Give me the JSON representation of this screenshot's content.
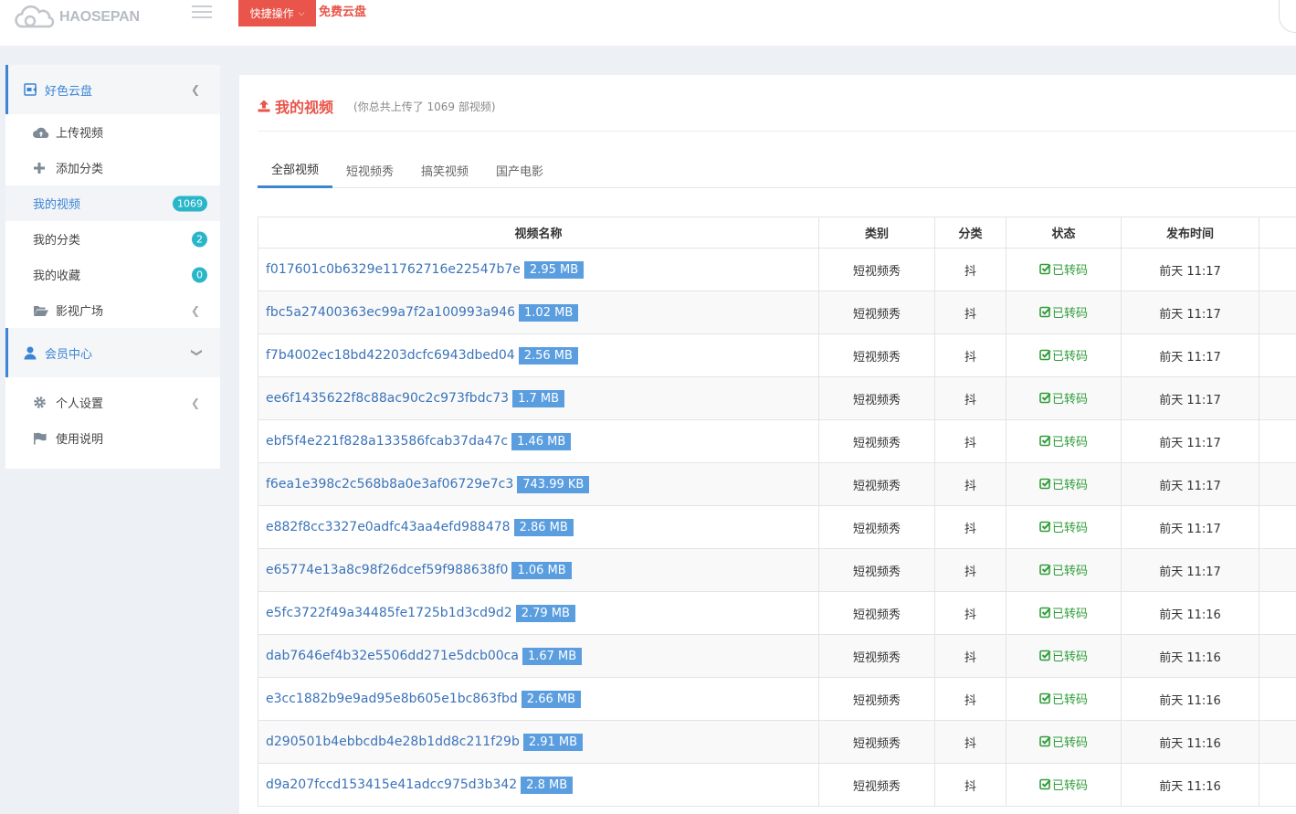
{
  "header": {
    "logo_text": "HAOSEPAN",
    "quick_actions_label": "快捷操作",
    "free_cloud_link": "免费云盘"
  },
  "sidebar": {
    "section1": {
      "label": "好色云盘"
    },
    "items": [
      {
        "label": "上传视频",
        "icon": "cloud-upload-icon"
      },
      {
        "label": "添加分类",
        "icon": "plus-icon"
      },
      {
        "label": "我的视频",
        "badge": "1069"
      },
      {
        "label": "我的分类",
        "badge": "2"
      },
      {
        "label": "我的收藏",
        "badge": "0"
      },
      {
        "label": "影视广场",
        "icon": "folder-open-icon"
      }
    ],
    "section2": {
      "label": "会员中心"
    },
    "items2": [
      {
        "label": "个人设置",
        "icon": "gear-icon"
      },
      {
        "label": "使用说明",
        "icon": "flag-icon"
      }
    ]
  },
  "main": {
    "title": "我的视频",
    "subtitle": "(你总共上传了 1069 部视频)",
    "tabs": [
      "全部视频",
      "短视频秀",
      "搞笑视频",
      "国产电影"
    ],
    "table": {
      "headers": [
        "视频名称",
        "类别",
        "分类",
        "状态",
        "发布时间"
      ],
      "rows": [
        {
          "name": "f017601c0b6329e11762716e22547b7e",
          "size": "2.95 MB",
          "category": "短视频秀",
          "tag": "抖",
          "status": "已转码",
          "time": "前天 11:17"
        },
        {
          "name": "fbc5a27400363ec99a7f2a100993a946",
          "size": "1.02 MB",
          "category": "短视频秀",
          "tag": "抖",
          "status": "已转码",
          "time": "前天 11:17"
        },
        {
          "name": "f7b4002ec18bd42203dcfc6943dbed04",
          "size": "2.56 MB",
          "category": "短视频秀",
          "tag": "抖",
          "status": "已转码",
          "time": "前天 11:17"
        },
        {
          "name": "ee6f1435622f8c88ac90c2c973fbdc73",
          "size": "1.7 MB",
          "category": "短视频秀",
          "tag": "抖",
          "status": "已转码",
          "time": "前天 11:17"
        },
        {
          "name": "ebf5f4e221f828a133586fcab37da47c",
          "size": "1.46 MB",
          "category": "短视频秀",
          "tag": "抖",
          "status": "已转码",
          "time": "前天 11:17"
        },
        {
          "name": "f6ea1e398c2c568b8a0e3af06729e7c3",
          "size": "743.99 KB",
          "category": "短视频秀",
          "tag": "抖",
          "status": "已转码",
          "time": "前天 11:17"
        },
        {
          "name": "e882f8cc3327e0adfc43aa4efd988478",
          "size": "2.86 MB",
          "category": "短视频秀",
          "tag": "抖",
          "status": "已转码",
          "time": "前天 11:17"
        },
        {
          "name": "e65774e13a8c98f26dcef59f988638f0",
          "size": "1.06 MB",
          "category": "短视频秀",
          "tag": "抖",
          "status": "已转码",
          "time": "前天 11:17"
        },
        {
          "name": "e5fc3722f49a34485fe1725b1d3cd9d2",
          "size": "2.79 MB",
          "category": "短视频秀",
          "tag": "抖",
          "status": "已转码",
          "time": "前天 11:16"
        },
        {
          "name": "dab7646ef4b32e5506dd271e5dcb00ca",
          "size": "1.67 MB",
          "category": "短视频秀",
          "tag": "抖",
          "status": "已转码",
          "time": "前天 11:16"
        },
        {
          "name": "e3cc1882b9e9ad95e8b605e1bc863fbd",
          "size": "2.66 MB",
          "category": "短视频秀",
          "tag": "抖",
          "status": "已转码",
          "time": "前天 11:16"
        },
        {
          "name": "d290501b4ebbcdb4e28b1dd8c211f29b",
          "size": "2.91 MB",
          "category": "短视频秀",
          "tag": "抖",
          "status": "已转码",
          "time": "前天 11:16"
        },
        {
          "name": "d9a207fccd153415e41adcc975d3b342",
          "size": "2.8 MB",
          "category": "短视频秀",
          "tag": "抖",
          "status": "已转码",
          "time": "前天 11:16"
        }
      ]
    }
  },
  "colors": {
    "accent": "#3b85d4",
    "brand_red": "#e9554a",
    "badge": "#29b6c9",
    "success": "#2e9d38",
    "size_tag": "#5b9ee0"
  }
}
